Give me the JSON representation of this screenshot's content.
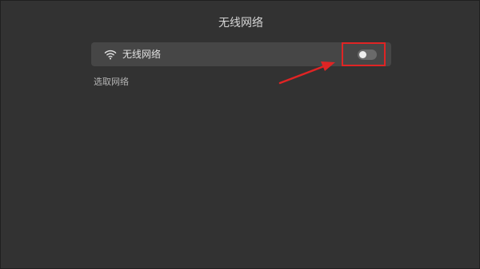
{
  "header": {
    "title": "无线网络"
  },
  "wifi_row": {
    "label": "无线网络",
    "icon": "wifi-icon",
    "toggle_state": "off"
  },
  "section": {
    "label": "选取网络"
  },
  "colors": {
    "background": "#323232",
    "row_background": "#464646",
    "annotation_red": "#e02424"
  }
}
